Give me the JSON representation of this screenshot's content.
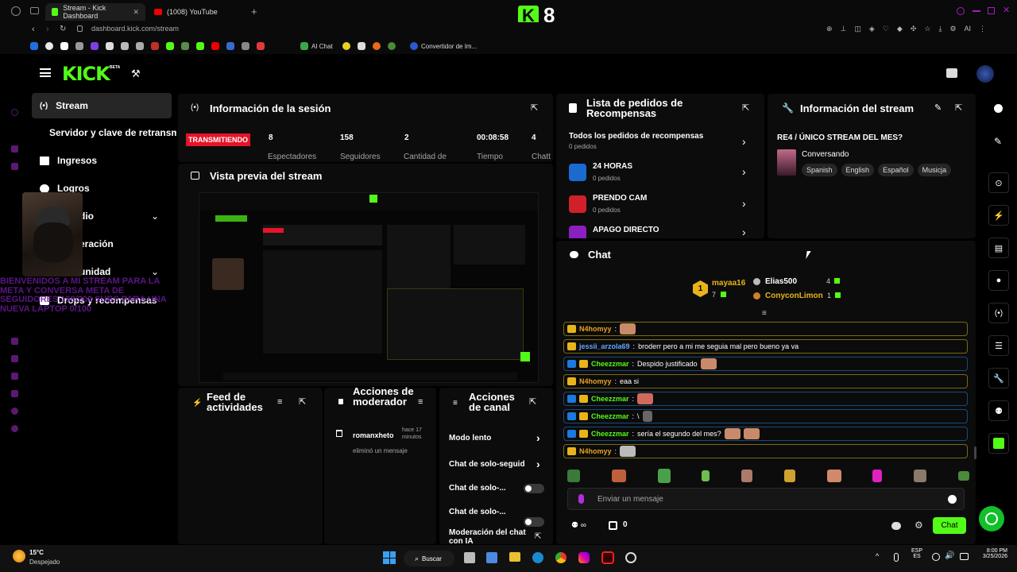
{
  "browser": {
    "tabs": [
      {
        "label": "Stream - Kick Dashboard",
        "active": true
      },
      {
        "label": "(1008) YouTube",
        "active": false
      }
    ],
    "address": "dashboard.kick.com/stream",
    "bookmarks": {
      "ai_chat": "AI Chat",
      "converter": "Convertidor de Im..."
    },
    "ai_label": "AI"
  },
  "overlay": {
    "logo_text": "K 8"
  },
  "header": {
    "logo": "KICK",
    "beta": "BETA"
  },
  "sidebar": {
    "items": [
      {
        "label": "Stream"
      },
      {
        "label": "Servidor y clave de retransm"
      },
      {
        "label": "Ingresos"
      },
      {
        "label": "Logros"
      },
      {
        "label": "dio"
      },
      {
        "label": "eración"
      },
      {
        "label": "unidad"
      },
      {
        "label": "Drops y recompensas"
      }
    ],
    "overlay_text": "BIENVENIDOS A MI STREAM PARA LA META Y CONVERSA META DE SEGUIDORES 158/200 SUBS PARA UNA NUEVA LAPTOP 0/100"
  },
  "session": {
    "title": "Información de la sesión",
    "status": "TRANSMITIENDO",
    "stats": [
      {
        "value": "8",
        "label": "Espectadores"
      },
      {
        "value": "158",
        "label": "Seguidores"
      },
      {
        "value": "2",
        "label": "Cantidad de"
      },
      {
        "value": "00:08:58",
        "label": "Tiempo"
      },
      {
        "value": "4",
        "label": "Chatt"
      }
    ]
  },
  "preview": {
    "title": "Vista previa del stream"
  },
  "rewards": {
    "title": "Lista de pedidos de Recompensas",
    "items": [
      {
        "name": "Todos los pedidos de recompensas",
        "count": "0 pedidos"
      },
      {
        "name": "24 HORAS",
        "count": "0 pedidos"
      },
      {
        "name": "PRENDO CAM",
        "count": "0 pedidos"
      },
      {
        "name": "APAGO DIRECTO",
        "count": ""
      }
    ]
  },
  "stream_info": {
    "title": "Información del stream",
    "stream_title": "RE4 / ÚNICO STREAM DEL MES?",
    "category": "Conversando",
    "tags": [
      "Spanish",
      "English",
      "Español",
      "Musicja"
    ]
  },
  "chat": {
    "title": "Chat",
    "leaderboard": [
      {
        "rank": "1",
        "name": "mayaa16",
        "count": "7"
      },
      {
        "name": "Elias500",
        "count": "4"
      },
      {
        "name": "ConyconLimon",
        "count": "1"
      }
    ],
    "messages": [
      {
        "user": "N4homyy",
        "text": "",
        "color": "#e8a020",
        "mod": false
      },
      {
        "user": "jessii_arzola69",
        "text": "broderr pero a mi me seguia mal pero bueno ya va",
        "color": "#62a8ff",
        "mod": false
      },
      {
        "user": "Cheezzmar",
        "text": "Despido justificado",
        "color": "#53fc18",
        "mod": true
      },
      {
        "user": "N4homyy",
        "text": "eaa si",
        "color": "#e8a020",
        "mod": false
      },
      {
        "user": "Cheezzmar",
        "text": "",
        "color": "#53fc18",
        "mod": true
      },
      {
        "user": "Cheezzmar",
        "text": "\\",
        "color": "#53fc18",
        "mod": true
      },
      {
        "user": "Cheezzmar",
        "text": "sería el segundo del mes?",
        "color": "#53fc18",
        "mod": true
      },
      {
        "user": "N4homyy",
        "text": "",
        "color": "#e8a020",
        "mod": false
      }
    ],
    "input_placeholder": "Enviar un mensaje",
    "points": "0",
    "send_label": "Chat"
  },
  "feed": {
    "title": "Feed de actividades"
  },
  "mod_actions": {
    "title": "Acciones de moderador",
    "entry_user": "romanxheto",
    "entry_time": "hace 17 minutos",
    "entry_action": "eliminó un mensaje"
  },
  "channel_actions": {
    "title": "Acciones de canal",
    "items": [
      {
        "label": "Modo lento"
      },
      {
        "label": "Chat de solo-seguid"
      },
      {
        "label": "Chat de solo-..."
      },
      {
        "label": "Chat de solo-..."
      },
      {
        "label": "Moderación del chat con IA"
      }
    ]
  },
  "taskbar": {
    "weather_temp": "15°C",
    "weather_desc": "Despejado",
    "search": "Buscar",
    "lang1": "ESP",
    "lang2": "ES",
    "time": "8:00 PM",
    "date": "3/25/2026"
  },
  "colors": {
    "kick_green": "#53fc18",
    "live_red": "#e5142a"
  }
}
